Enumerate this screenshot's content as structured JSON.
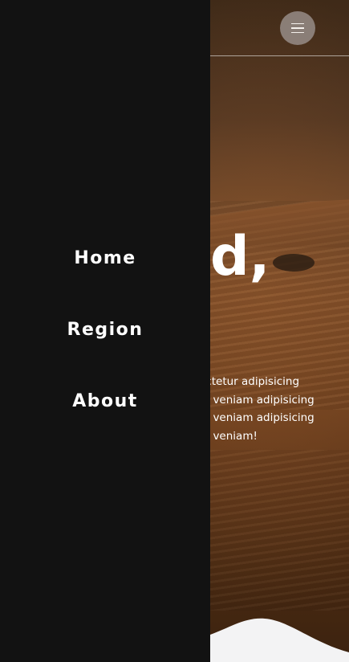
{
  "nav": {
    "items": [
      {
        "label": "Home"
      },
      {
        "label": "Region"
      },
      {
        "label": "About"
      }
    ]
  },
  "header": {
    "menu_icon": "hamburger-menu-icon"
  },
  "hero": {
    "headline_visible": "d,",
    "paragraph_lines": [
      "ectetur adipisicing",
      "m veniam adipisicing",
      "m veniam adipisicing",
      "m veniam!"
    ]
  },
  "colors": {
    "drawer_bg": "#121212",
    "nav_text": "#ffffff",
    "toggle_bg": "#968c87",
    "wave": "#f3f3f4"
  }
}
